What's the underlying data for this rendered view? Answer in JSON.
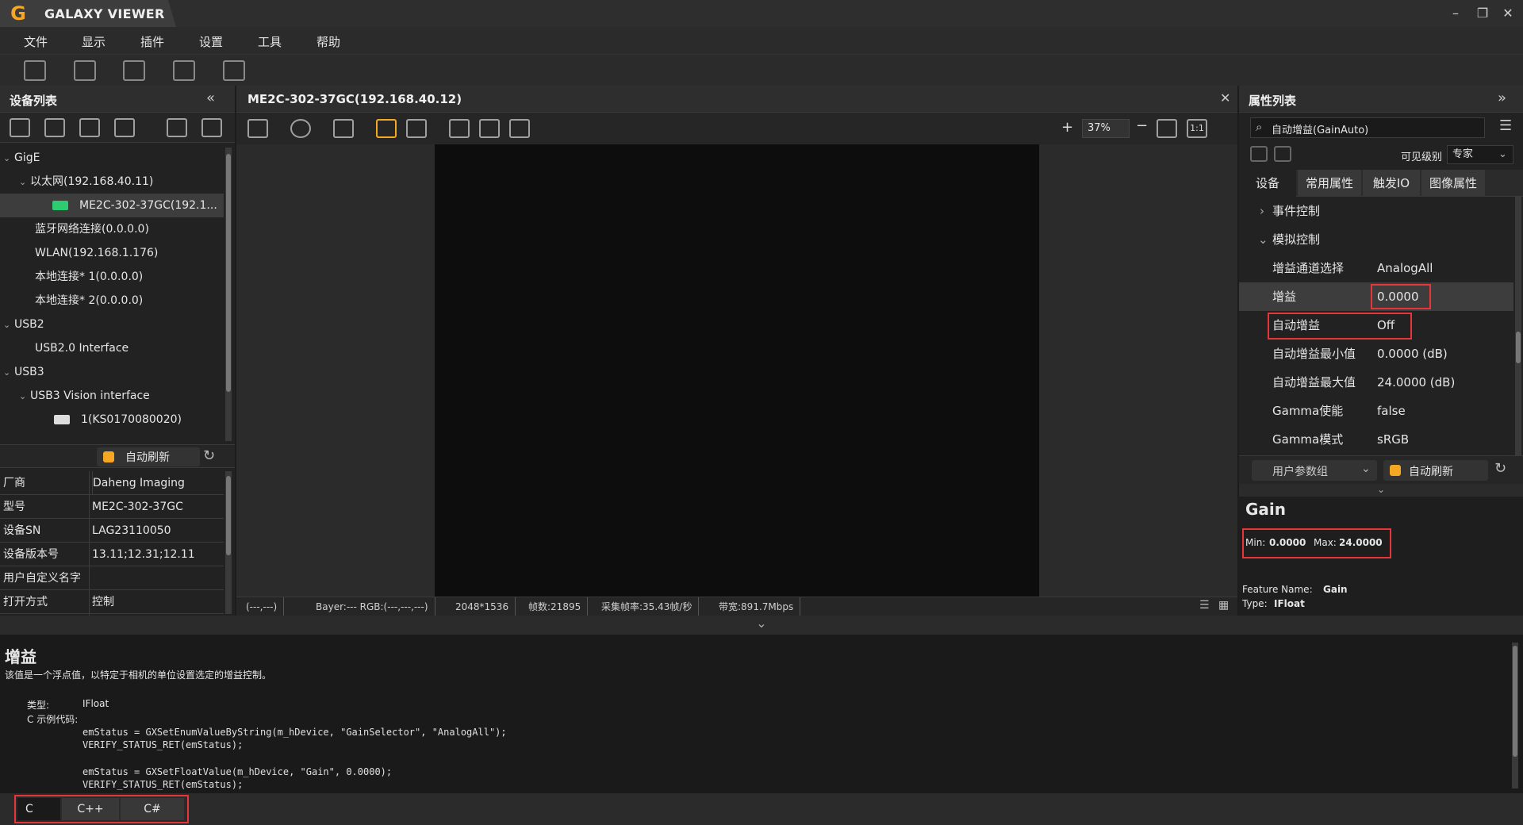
{
  "app": {
    "title": "GALAXY VIEWER",
    "logo_glyph": "G"
  },
  "window_controls": {
    "minimize": "–",
    "restore": "❐",
    "close": "✕"
  },
  "menu": [
    "文件",
    "显示",
    "插件",
    "设置",
    "工具",
    "帮助"
  ],
  "device_panel": {
    "title": "设备列表",
    "collapse_glyph": "«",
    "tree": [
      {
        "label": "GigE",
        "caret": "⌄"
      },
      {
        "label": "以太网(192.168.40.11)",
        "caret": "⌄"
      },
      {
        "label": "ME2C-302-37GC(192.1...",
        "selected": true
      },
      {
        "label": "蓝牙网络连接(0.0.0.0)"
      },
      {
        "label": "WLAN(192.168.1.176)"
      },
      {
        "label": "本地连接* 1(0.0.0.0)"
      },
      {
        "label": "本地连接* 2(0.0.0.0)"
      },
      {
        "label": "USB2",
        "caret": "⌄"
      },
      {
        "label": "USB2.0 Interface"
      },
      {
        "label": "USB3",
        "caret": "⌄"
      },
      {
        "label": "USB3 Vision interface",
        "caret": "⌄"
      },
      {
        "label": "1(KS0170080020)"
      }
    ],
    "auto_refresh": "自动刷新",
    "info": [
      {
        "key": "厂商",
        "value": "Daheng Imaging"
      },
      {
        "key": "型号",
        "value": "ME2C-302-37GC"
      },
      {
        "key": "设备SN",
        "value": "LAG23110050"
      },
      {
        "key": "设备版本号",
        "value": "13.11;12.31;12.11"
      },
      {
        "key": "用户自定义名字",
        "value": ""
      },
      {
        "key": "打开方式",
        "value": "控制"
      }
    ]
  },
  "viewer": {
    "tab_title": "ME2C-302-37GC(192.168.40.12)",
    "close_glyph": "✕",
    "zoom_in": "+",
    "zoom": "37%",
    "zoom_out": "−",
    "one_to_one": "1:1",
    "status": {
      "coord": "(---,---)",
      "pixel": "Bayer:---  RGB:(---,---,---)",
      "resolution": "2048*1536",
      "frames": "帧数:21895",
      "fps": "采集帧率:35.43帧/秒",
      "bandwidth": "带宽:891.7Mbps"
    }
  },
  "property_panel": {
    "title": "属性列表",
    "expand_glyph": "»",
    "search_value": "自动增益(GainAuto)",
    "visibility_label": "可见级别",
    "visibility_value": "专家",
    "tabs": [
      "设备",
      "常用属性",
      "触发IO",
      "图像属性"
    ],
    "rows": [
      {
        "name": "事件控制",
        "value": "",
        "caret": "›",
        "group": true
      },
      {
        "name": "模拟控制",
        "value": "",
        "caret": "⌄",
        "group": true
      },
      {
        "name": "增益通道选择",
        "value": "AnalogAll"
      },
      {
        "name": "增益",
        "value": "0.0000",
        "selected": true
      },
      {
        "name": "自动增益",
        "value": "Off"
      },
      {
        "name": "自动增益最小值",
        "value": "0.0000 (dB)"
      },
      {
        "name": "自动增益最大值",
        "value": "24.0000 (dB)"
      },
      {
        "name": "Gamma使能",
        "value": "false"
      },
      {
        "name": "Gamma模式",
        "value": "sRGB"
      }
    ],
    "user_param_group": "用户参数组",
    "auto_refresh": "自动刷新",
    "info": {
      "title": "Gain",
      "min_label": "Min:",
      "min_value": "0.0000",
      "max_label": "Max:",
      "max_value": "24.0000",
      "feature_name_label": "Feature Name:",
      "feature_name_value": "Gain",
      "type_label": "Type:",
      "type_value": "IFloat"
    }
  },
  "description": {
    "title": "增益",
    "text": "该值是一个浮点值，以特定于相机的单位设置选定的增益控制。",
    "type_label": "类型:",
    "type_value": "IFloat",
    "code_label": "C 示例代码:",
    "code_lines": [
      "emStatus = GXSetEnumValueByString(m_hDevice, \"GainSelector\", \"AnalogAll\");",
      "VERIFY_STATUS_RET(emStatus);",
      "",
      "emStatus = GXSetFloatValue(m_hDevice, \"Gain\", 0.0000);",
      "VERIFY_STATUS_RET(emStatus);"
    ],
    "lang_tabs": [
      "C",
      "C++",
      "C#"
    ]
  },
  "colors": {
    "accent_red": "#e8353b",
    "logo_orange": "#f5a623",
    "camera_green": "#2ecc71"
  }
}
